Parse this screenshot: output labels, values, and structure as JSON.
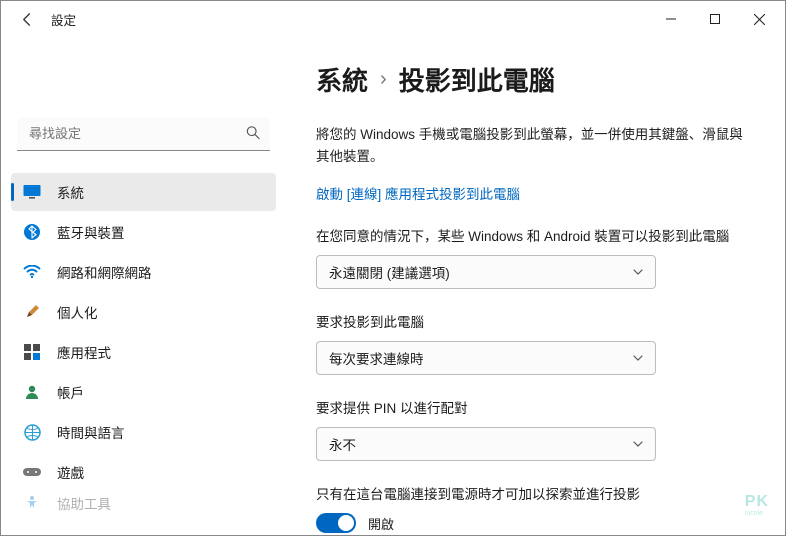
{
  "window": {
    "title": "設定"
  },
  "search": {
    "placeholder": "尋找設定"
  },
  "sidebar": {
    "items": [
      {
        "label": "系統"
      },
      {
        "label": "藍牙與裝置"
      },
      {
        "label": "網路和網際網路"
      },
      {
        "label": "個人化"
      },
      {
        "label": "應用程式"
      },
      {
        "label": "帳戶"
      },
      {
        "label": "時間與語言"
      },
      {
        "label": "遊戲"
      },
      {
        "label": "協助工具"
      }
    ]
  },
  "breadcrumb": {
    "root": "系統",
    "sep": "›",
    "leaf": "投影到此電腦"
  },
  "page": {
    "description": "將您的 Windows 手機或電腦投影到此螢幕，並一併使用其鍵盤、滑鼠與其他裝置。",
    "link": "啟動 [連線] 應用程式投影到此電腦",
    "field1": {
      "label": "在您同意的情況下，某些 Windows 和 Android 裝置可以投影到此電腦",
      "value": "永遠關閉 (建議選項)"
    },
    "field2": {
      "label": "要求投影到此電腦",
      "value": "每次要求連線時"
    },
    "field3": {
      "label": "要求提供 PIN 以進行配對",
      "value": "永不"
    },
    "field4": {
      "label": "只有在這台電腦連接到電源時才可加以探索並進行投影",
      "toggle_state": "開啟"
    }
  },
  "watermark": {
    "main": "PK",
    "sub": "nicole"
  }
}
